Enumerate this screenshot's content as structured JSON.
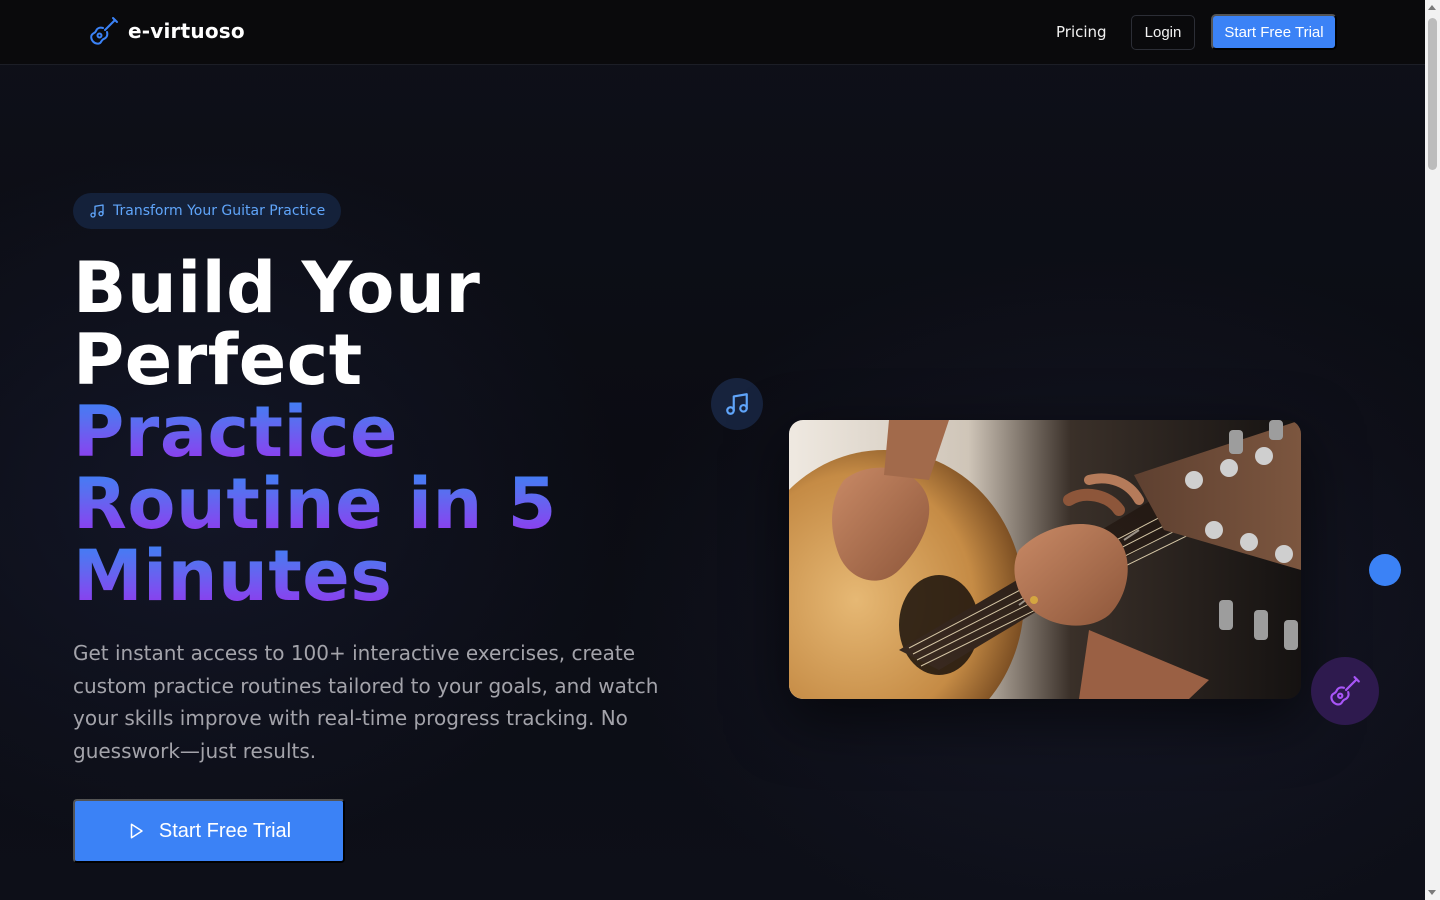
{
  "nav": {
    "brand_name": "e-virtuoso",
    "brand_icon": "guitar-icon",
    "pricing_label": "Pricing",
    "login_label": "Login",
    "trial_label": "Start Free Trial"
  },
  "hero": {
    "badge_icon": "music-note-icon",
    "badge_text": "Transform Your Guitar Practice",
    "headline_line1": "Build Your",
    "headline_line2": "Perfect",
    "headline_line3": "Practice",
    "headline_line4": "Routine in 5",
    "headline_line5": "Minutes",
    "subtext": "Get instant access to 100+ interactive exercises, create custom practice routines tailored to your goals, and watch your skills improve with real-time progress tracking. No guesswork—just results.",
    "cta_label": "Start Free Trial",
    "cta_icon": "play-icon"
  },
  "visual": {
    "photo_alt": "Hands playing an acoustic guitar",
    "float_note_icon": "music-note-icon",
    "float_guitar_icon": "guitar-icon"
  },
  "colors": {
    "accent": "#3b82f6",
    "accent_purple": "#9333ea",
    "background": "#0c0d14",
    "navbar": "#0a0a0c",
    "muted_text": "#a3a3aa"
  }
}
